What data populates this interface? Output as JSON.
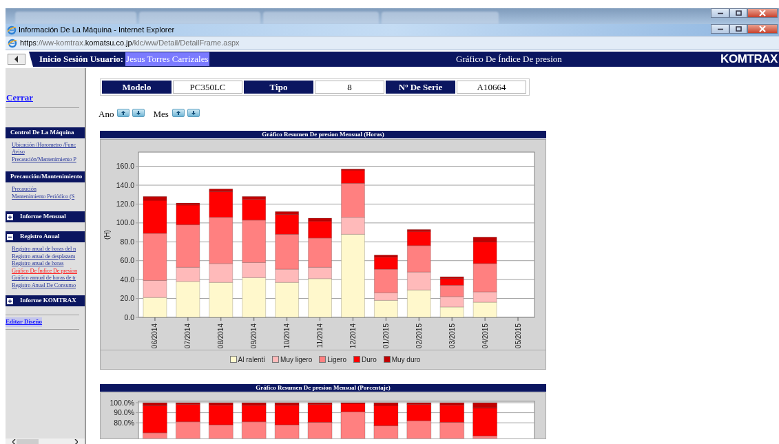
{
  "window": {
    "title": "Información De La Máquina - Internet Explorer"
  },
  "address_bar": {
    "url": [
      {
        "text": "https",
        "emphasis": true
      },
      {
        "text": "://ww-komtrax.",
        "emphasis": false
      },
      {
        "text": "komatsu.co.jp",
        "emphasis": true
      },
      {
        "text": "/klc/ww/Detail/DetailFrame.aspx",
        "emphasis": false
      }
    ]
  },
  "header": {
    "user_label": "Inicio Sesión Usuario:",
    "user_name": "Jesus Torres Carrizales",
    "page_title": "Gráfico De Índice De presion",
    "logo": "KOMTRAX"
  },
  "sidebar": {
    "close_link": "Cerrar",
    "sections": [
      {
        "title": "Control De La Máquina",
        "kind": "plain",
        "links": [
          {
            "label": "Ubicación /Horometro /Func",
            "selected": false
          },
          {
            "label": "Aviso",
            "selected": false
          },
          {
            "label": "Precaución/Mantenimiento P",
            "selected": false
          }
        ]
      },
      {
        "title": "Precaución/Mantenimiento",
        "kind": "plain",
        "links": [
          {
            "label": "Precaución",
            "selected": false
          },
          {
            "label": "Mantenimiento Periódico (S",
            "selected": false
          }
        ]
      },
      {
        "title": "Informe Mensual",
        "kind": "collapsible",
        "expanded": false
      },
      {
        "title": "Registro Anual",
        "kind": "collapsible",
        "expanded": true,
        "links": [
          {
            "label": "Registro anual de horas del n",
            "selected": false
          },
          {
            "label": "Registro anual de desplazam",
            "selected": false
          },
          {
            "label": "Registro anual de horas",
            "selected": false
          },
          {
            "label": "Gráfico De Índice De presion",
            "selected": true
          },
          {
            "label": "Gráfico annual de horas de tr",
            "selected": false
          },
          {
            "label": "Registro Anual De Consumo",
            "selected": false
          }
        ]
      },
      {
        "title": "Informe KOMTRAX",
        "kind": "collapsible",
        "expanded": false
      }
    ],
    "edit_link": "Editar Diseño"
  },
  "machine": {
    "fields": [
      {
        "label": "Modelo",
        "value": "PC350LC"
      },
      {
        "label": "Tipo",
        "value": "8"
      },
      {
        "label": "Nº De Serie",
        "value": "A10664"
      }
    ]
  },
  "navigation": [
    {
      "label": "Ano"
    },
    {
      "label": "Mes"
    }
  ],
  "charts": [
    {
      "title": "Gráfico Resumen De presion Mensual (Horas)",
      "chart_data": {
        "type": "bar",
        "stacked": true,
        "grid": true,
        "legend": true,
        "ylabel": "(H)",
        "categories": [
          "06/2014",
          "07/2014",
          "08/2014",
          "09/2014",
          "10/2014",
          "11/2014",
          "12/2014",
          "01/2015",
          "02/2015",
          "03/2015",
          "04/2015",
          "05/2015"
        ],
        "ylim": [
          0,
          175
        ],
        "yticks": [
          {
            "value": 0,
            "label": "0.0"
          },
          {
            "value": 20,
            "label": "20.0"
          },
          {
            "value": 40,
            "label": "40.0"
          },
          {
            "value": 60,
            "label": "60.0"
          },
          {
            "value": 80,
            "label": "80.0"
          },
          {
            "value": 100,
            "label": "100.0"
          },
          {
            "value": 120,
            "label": "120.0"
          },
          {
            "value": 140,
            "label": "140.0"
          },
          {
            "value": 160,
            "label": "160.0"
          }
        ],
        "series": [
          {
            "name": "Al ralentí",
            "color": "#fff8cc",
            "values": [
              21,
              38,
              37,
              42,
              37,
              41,
              88,
              18,
              29,
              11,
              16,
              null
            ]
          },
          {
            "name": "Muy ligero",
            "color": "#ffbaba",
            "values": [
              18,
              15,
              20,
              16,
              14,
              12,
              18,
              8,
              19,
              11,
              11,
              null
            ]
          },
          {
            "name": "Ligero",
            "color": "#ff8080",
            "values": [
              50,
              45,
              49,
              45,
              37,
              31,
              36,
              25,
              28,
              12,
              30,
              null
            ]
          },
          {
            "name": "Duro",
            "color": "#ff0000",
            "values": [
              35,
              21,
              27,
              22,
              21,
              18,
              14,
              13,
              15,
              7,
              23,
              null
            ]
          },
          {
            "name": "Muy duro",
            "color": "#c00000",
            "values": [
              4,
              2,
              3,
              3,
              3,
              3,
              1,
              2,
              2,
              2,
              5,
              null
            ]
          }
        ]
      }
    },
    {
      "title": "Gráfico Resumen De presion Mensual (Porcentaje)",
      "chart_data": {
        "type": "bar",
        "stacked": true,
        "grid": true,
        "ylim": [
          0,
          100
        ],
        "yticks": [
          {
            "value": 80,
            "label": "80.0%"
          },
          {
            "value": 90,
            "label": "90.0%"
          },
          {
            "value": 100,
            "label": "100.0%"
          }
        ],
        "series": [
          {
            "color": "#ff8080",
            "values": [
              70,
              81,
              78,
              81,
              78,
              80.5,
              91,
              77,
              82,
              80.5,
              67,
              null
            ]
          },
          {
            "color": "#ff0000",
            "values": [
              27,
              17.4,
              19.7,
              16.5,
              19.5,
              17.9,
              8.3,
              20.3,
              16.4,
              17.2,
              27.7,
              null
            ]
          },
          {
            "color": "#c00000",
            "values": [
              3,
              1.6,
              2.3,
              2.5,
              2.5,
              1.6,
              0.7,
              2.7,
              1.6,
              2.3,
              5.3,
              null
            ]
          }
        ]
      }
    }
  ]
}
